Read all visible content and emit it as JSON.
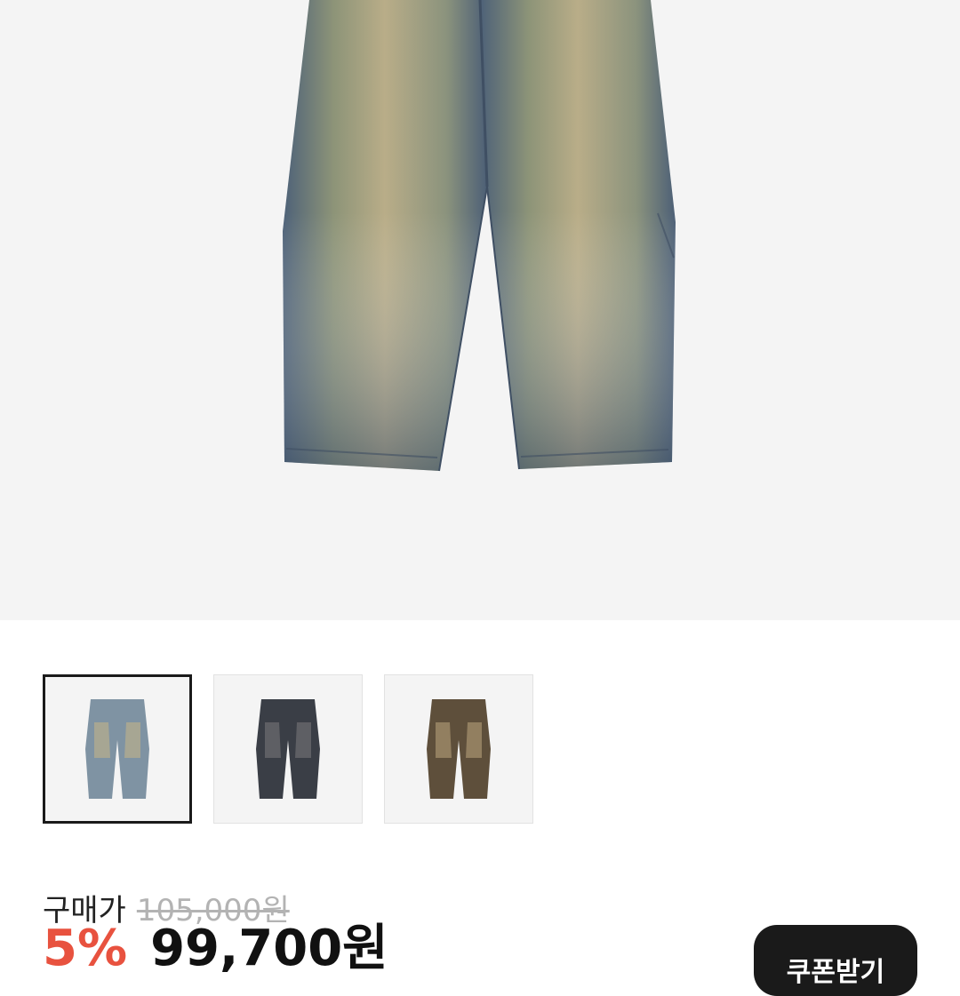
{
  "hero": {
    "image_alt": "denim-pants-main-image"
  },
  "thumbnails": [
    {
      "name": "blue-wash",
      "selected": true,
      "color_light": "#7f93a3",
      "color_dark": "#4a5a6b",
      "fade": "#b8ae8c"
    },
    {
      "name": "black-wash",
      "selected": false,
      "color_light": "#555a63",
      "color_dark": "#2a2d33",
      "fade": "#6d6d70"
    },
    {
      "name": "brown-wash",
      "selected": false,
      "color_light": "#7d6a50",
      "color_dark": "#4a3e2e",
      "fade": "#a89470"
    }
  ],
  "price": {
    "label": "구매가",
    "original": "105,000원",
    "discount": "5%",
    "sale": "99,700원"
  },
  "coupon_button": {
    "label": "쿠폰받기"
  },
  "colors": {
    "discount": "#e8523f",
    "button_bg": "#1a1a1a"
  }
}
